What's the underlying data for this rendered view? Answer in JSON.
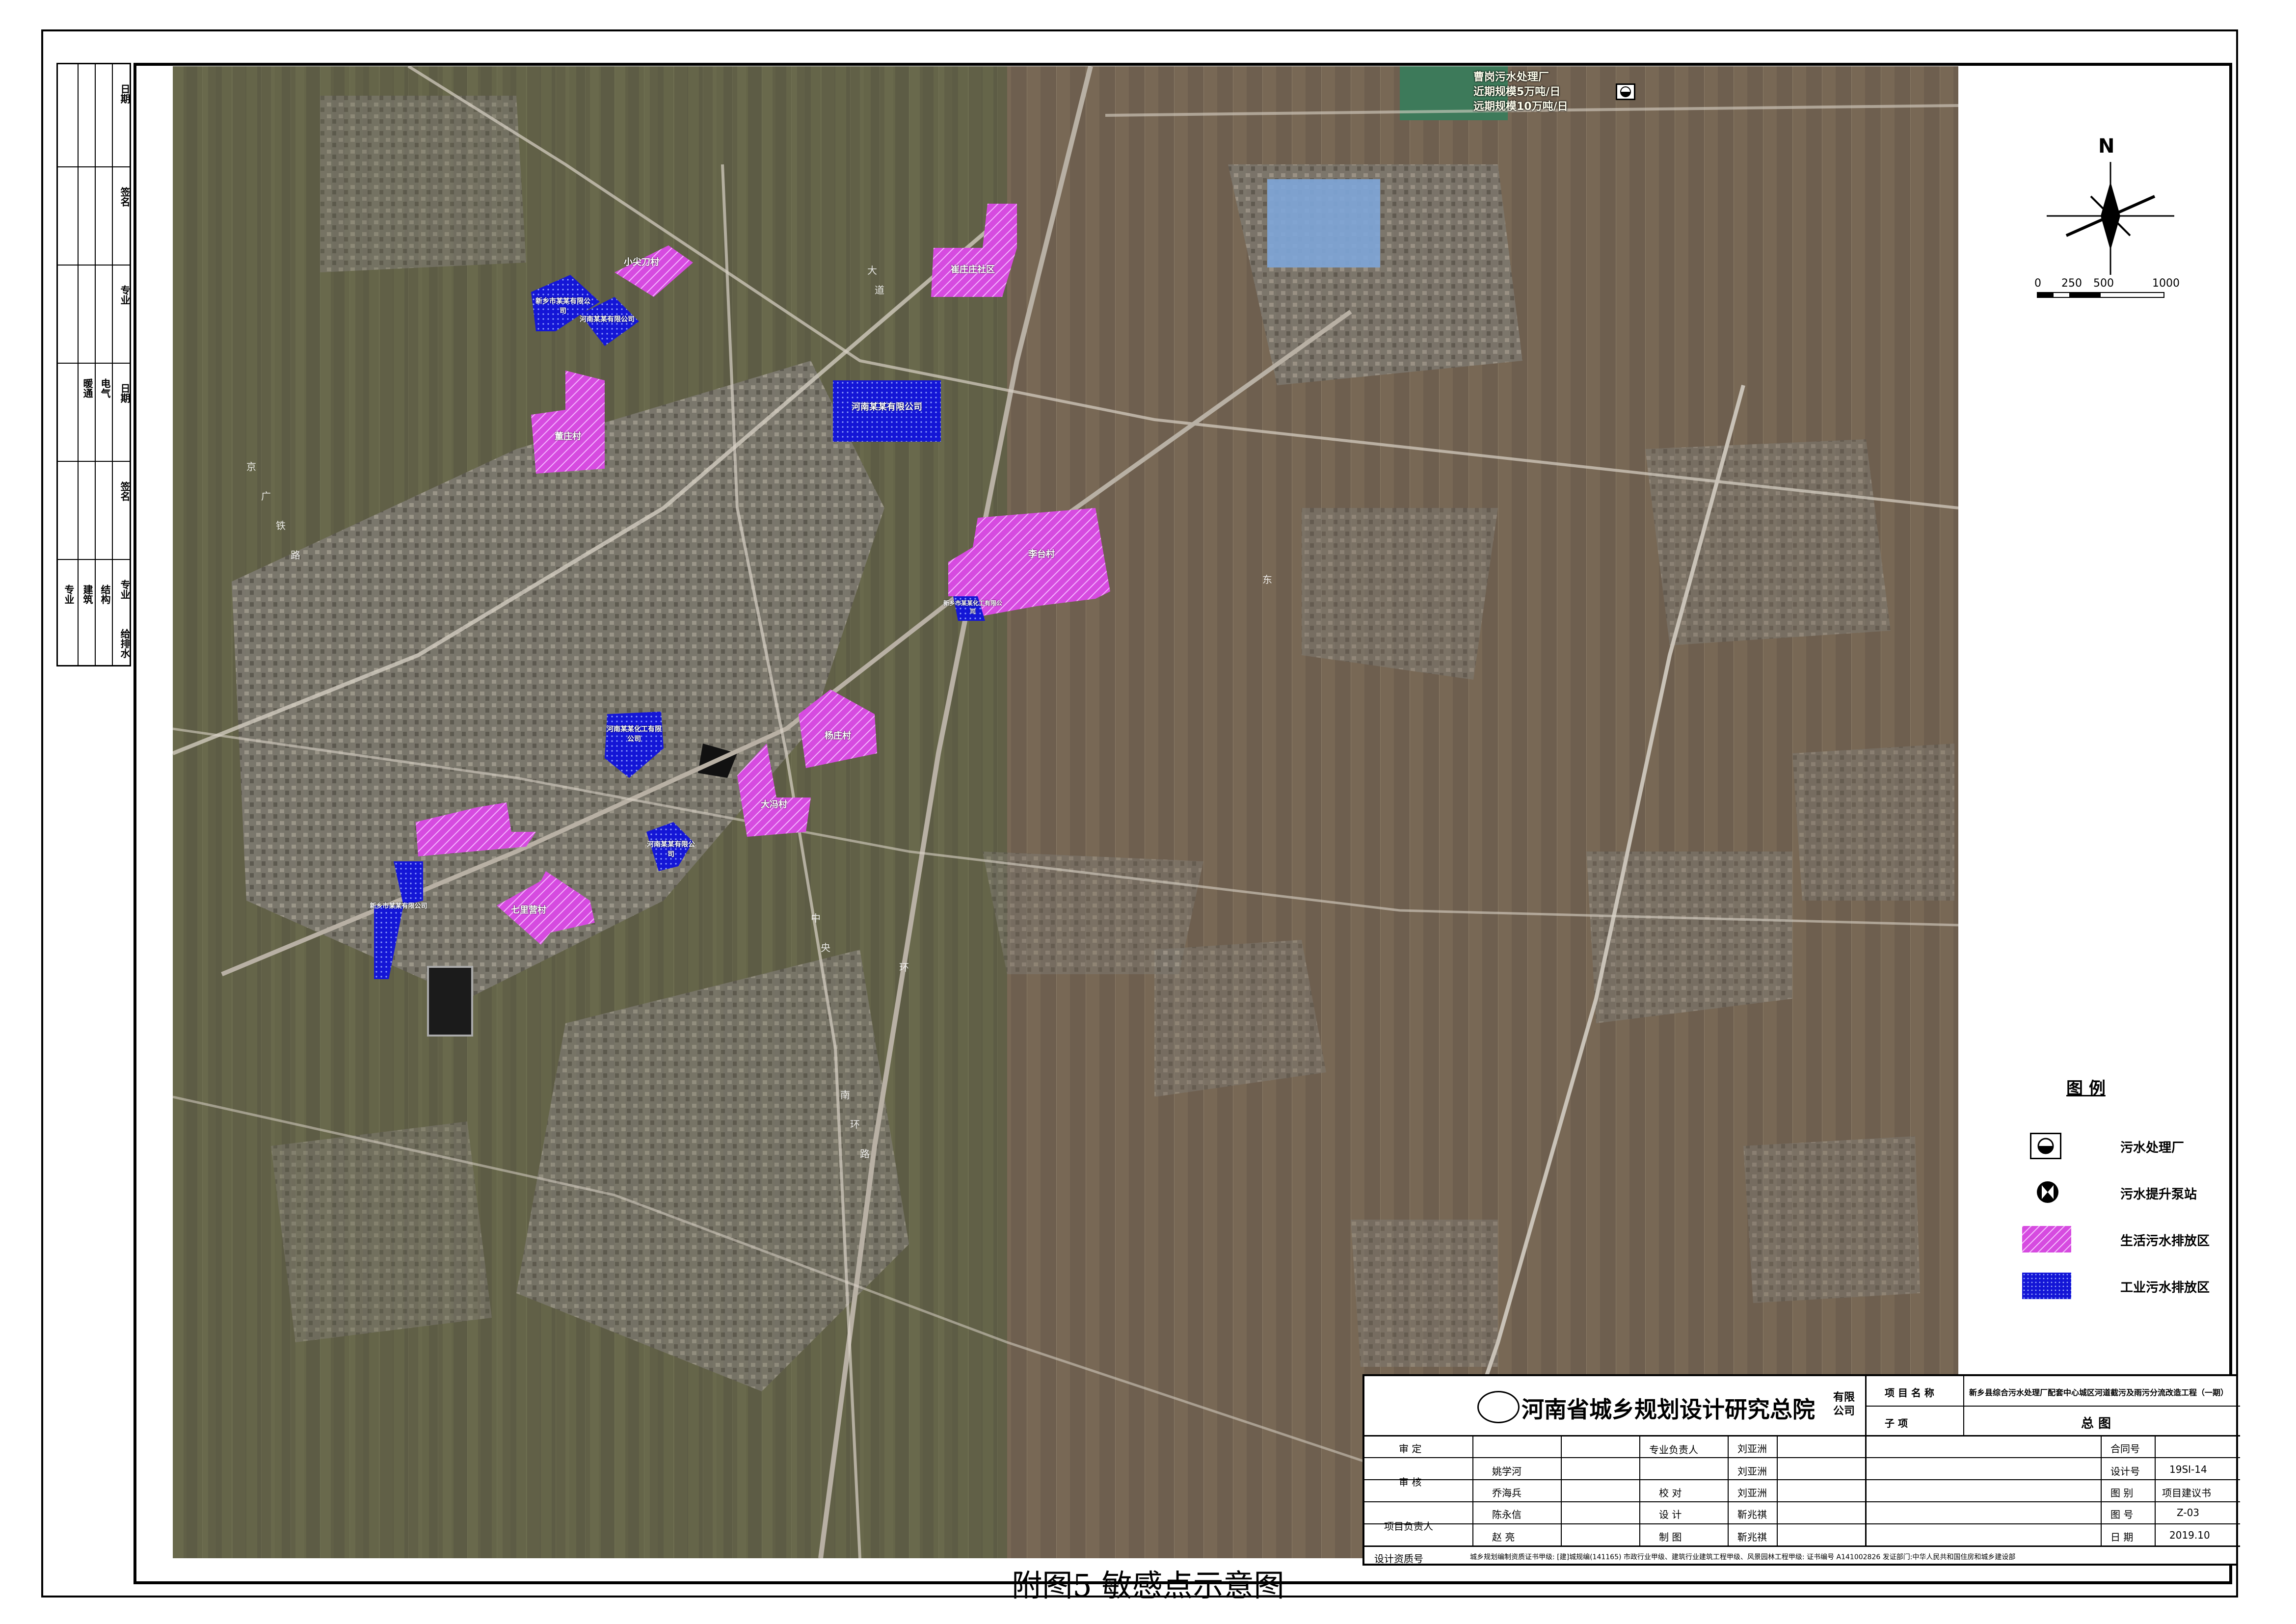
{
  "caption": "附图5  敏感点示意图",
  "left_strip": {
    "top_labels": [
      "日期",
      "签名",
      "专业",
      "日期",
      "签名",
      "专业"
    ],
    "mid_labels": [
      "专业",
      "建筑",
      "结构",
      "给排水",
      "电气",
      "暖通"
    ]
  },
  "compass": {
    "north": "N",
    "scale_labels": [
      "0",
      "250",
      "500",
      "1000"
    ]
  },
  "legend": {
    "title": "图 例",
    "items": [
      {
        "label": "污水处理厂",
        "symbol": "treatment-plant"
      },
      {
        "label": "污水提升泵站",
        "symbol": "pump-station"
      },
      {
        "label": "生活污水排放区",
        "symbol": "domestic-zone"
      },
      {
        "label": "工业污水排放区",
        "symbol": "industrial-zone"
      }
    ]
  },
  "map": {
    "top_notice": [
      "曹岗污水处理厂",
      "近期规模5万吨/日",
      "远期规模10万吨/日"
    ],
    "zones": [
      {
        "id": "z1",
        "type": "domestic",
        "label": "小尖刀村"
      },
      {
        "id": "z2",
        "type": "domestic",
        "label": "崔庄庄社区"
      },
      {
        "id": "z3",
        "type": "industrial",
        "label": "新乡市某某有限公司"
      },
      {
        "id": "z4",
        "type": "industrial",
        "label": "河南某某有限公司"
      },
      {
        "id": "z5",
        "type": "domestic",
        "label": "董庄村"
      },
      {
        "id": "z6",
        "type": "industrial",
        "label": "河南某某有限公司"
      },
      {
        "id": "z7",
        "type": "domestic",
        "label": "李台村"
      },
      {
        "id": "z8",
        "type": "industrial",
        "label": "新乡市某某化工有限公司"
      },
      {
        "id": "z9",
        "type": "domestic",
        "label": "杨庄村"
      },
      {
        "id": "z10",
        "type": "industrial",
        "label": "河南某某化工有限公司"
      },
      {
        "id": "z11",
        "type": "domestic",
        "label": "大冯村"
      },
      {
        "id": "z12",
        "type": "domestic",
        "label": ""
      },
      {
        "id": "z13",
        "type": "industrial",
        "label": "河南某某有限公司"
      },
      {
        "id": "z14",
        "type": "industrial",
        "label": "新乡市某某有限公司"
      },
      {
        "id": "z15",
        "type": "domestic",
        "label": "七里营村"
      }
    ],
    "road_labels": [
      "新乡",
      "东",
      "路",
      "大",
      "道",
      "环",
      "中",
      "央",
      "大",
      "道",
      "南",
      "环",
      "路",
      "京",
      "广",
      "铁",
      "路"
    ]
  },
  "title_block": {
    "institute": "河南省城乡规划设计研究总院",
    "institute_suffix": "有限公司",
    "project_name_label": "项 目 名 称",
    "project_name": "新乡县综合污水处理厂配套中心城区河道截污及雨污分流改造工程（一期）",
    "sub_item_label": "子        项",
    "drawing_title": "总 图",
    "roles": [
      {
        "role": "审 定",
        "name": ""
      },
      {
        "role": "审 核",
        "name": "姚学河"
      },
      {
        "role": "",
        "name": "乔海兵"
      },
      {
        "role": "项目负责人",
        "name": "陈永信"
      },
      {
        "role": "",
        "name": "赵 亮"
      }
    ],
    "roles2": [
      {
        "role": "专业负责人",
        "name": "刘亚洲"
      },
      {
        "role": "",
        "name": "刘亚洲"
      },
      {
        "role": "校 对",
        "name": "刘亚洲"
      },
      {
        "role": "设 计",
        "name": "靳兆祺"
      },
      {
        "role": "制 图",
        "name": "靳兆祺"
      }
    ],
    "meta": [
      {
        "key": "合同号",
        "value": ""
      },
      {
        "key": "设计号",
        "value": "19SI-14"
      },
      {
        "key": "图 别",
        "value": "项目建议书"
      },
      {
        "key": "图 号",
        "value": "Z-03"
      },
      {
        "key": "日 期",
        "value": "2019.10"
      }
    ],
    "qualification_label": "设计资质号",
    "qualification": "城乡规划编制资质证书甲级: [建]城规编(141165)   市政行业甲级、建筑行业建筑工程甲级、风景园林工程甲级: 证书编号 A141002826   发证部门:中华人民共和国住房和城乡建设部"
  }
}
